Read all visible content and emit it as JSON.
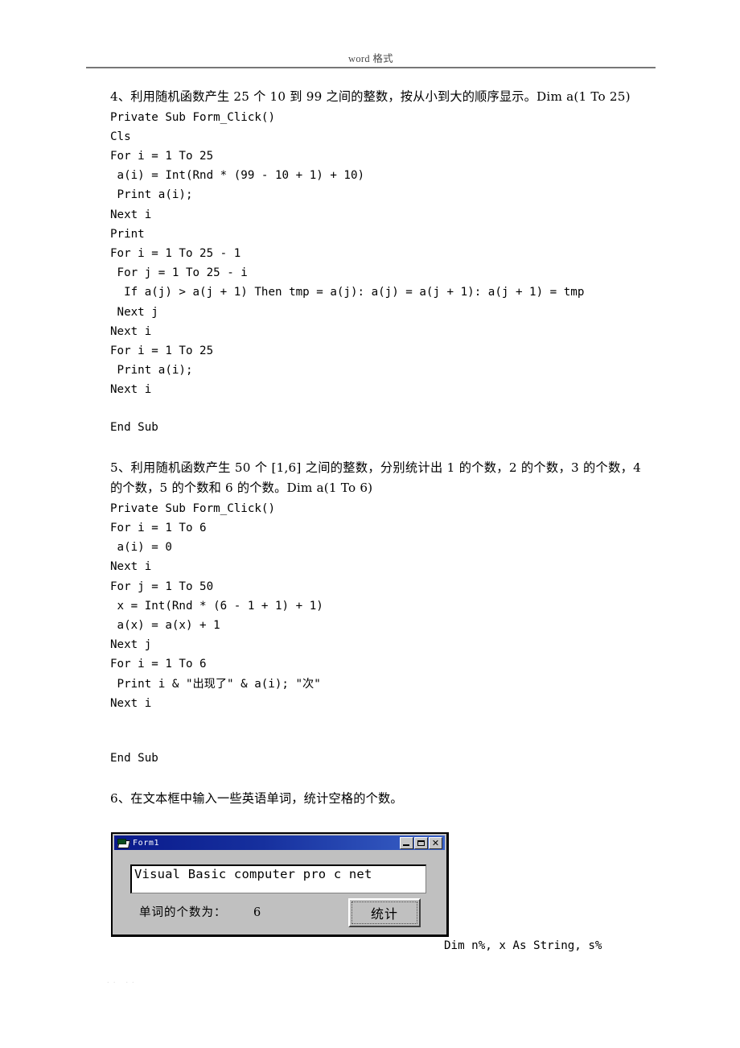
{
  "header": {
    "title": "word 格式"
  },
  "sections": [
    {
      "id": "q4",
      "prompt": "4、利用随机函数产生 25 个 10 到 99 之间的整数，按从小到大的顺序显示。Dim a(1 To 25)",
      "code": [
        "Private Sub Form_Click()",
        "Cls",
        "For i = 1 To 25",
        " a(i) = Int(Rnd * (99 - 10 + 1) + 10)",
        " Print a(i);",
        "Next i",
        "Print",
        "For i = 1 To 25 - 1",
        " For j = 1 To 25 - i",
        "  If a(j) > a(j + 1) Then tmp = a(j): a(j) = a(j + 1): a(j + 1) = tmp",
        " Next j",
        "Next i",
        "For i = 1 To 25",
        " Print a(i);",
        "Next i",
        "",
        "End Sub"
      ]
    },
    {
      "id": "q5",
      "prompt": "5、利用随机函数产生 50 个 [1,6] 之间的整数，分别统计出 1 的个数，2 的个数，3 的个数，4 的个数，5 的个数和 6 的个数。Dim a(1 To 6)",
      "code": [
        "Private Sub Form_Click()",
        "For i = 1 To 6",
        " a(i) = 0",
        "Next i",
        "For j = 1 To 50",
        " x = Int(Rnd * (6 - 1 + 1) + 1)",
        " a(x) = a(x) + 1",
        "Next j",
        "For i = 1 To 6",
        " Print i & \"出现了\" & a(i); \"次\"",
        "Next i",
        "",
        "",
        "End Sub"
      ]
    },
    {
      "id": "q6",
      "prompt": "6、在文本框中输入一些英语单词，统计空格的个数。",
      "code": []
    }
  ],
  "vb_form": {
    "title": "Form1",
    "icon": "vb-form-icon",
    "buttons": {
      "minimize": "minimize-icon",
      "maximize": "maximize-icon",
      "close": "close-icon"
    },
    "textbox_value": "Visual Basic computer pro c net",
    "label": "单词的个数为：",
    "count": "6",
    "action_button": "统计"
  },
  "trailing_code": "Dim n%, x As String, s%",
  "footer": ".. ..",
  "colors": {
    "titlebar_start": "#0a1a8c",
    "titlebar_end": "#3a62c8",
    "form_face": "#c0c0c0",
    "header_rule": "#777777",
    "text": "#000000"
  }
}
